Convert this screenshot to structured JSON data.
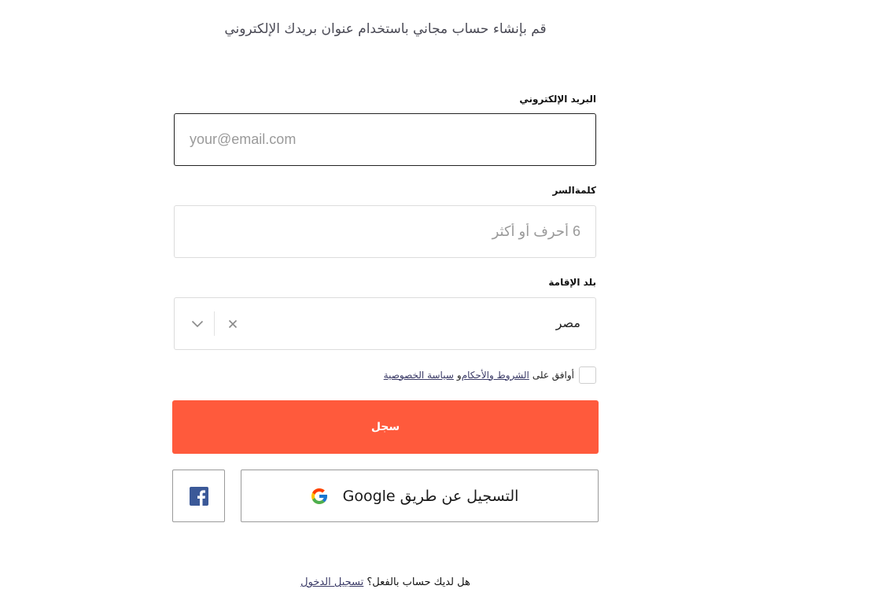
{
  "header": {
    "subtitle": "قم بإنشاء حساب مجاني باستخدام عنوان بريدك الإلكتروني"
  },
  "form": {
    "email": {
      "label": "البريد الإلكتروني",
      "placeholder": "your@email.com",
      "value": ""
    },
    "password": {
      "label": "كلمةالسر",
      "placeholder": "6 أحرف أو أكثر",
      "value": ""
    },
    "country": {
      "label": "بلد الإقامة",
      "value": "مصر"
    },
    "terms": {
      "checked": false,
      "prefix": "أوافق على",
      "terms_link": "الشروط والأحكام",
      "connector": "و",
      "privacy_link": "سياسة الخصوصية"
    },
    "submit_label": "سجل"
  },
  "social": {
    "google_label": "التسجيل عن طريق Google",
    "facebook_icon": "facebook-icon",
    "google_icon": "google-icon",
    "facebook_color": "#3b5998"
  },
  "footer": {
    "question": "هل لديك حساب بالفعل؟",
    "login_link": "تسجيل الدخول"
  },
  "colors": {
    "accent": "#ff5a3c"
  }
}
